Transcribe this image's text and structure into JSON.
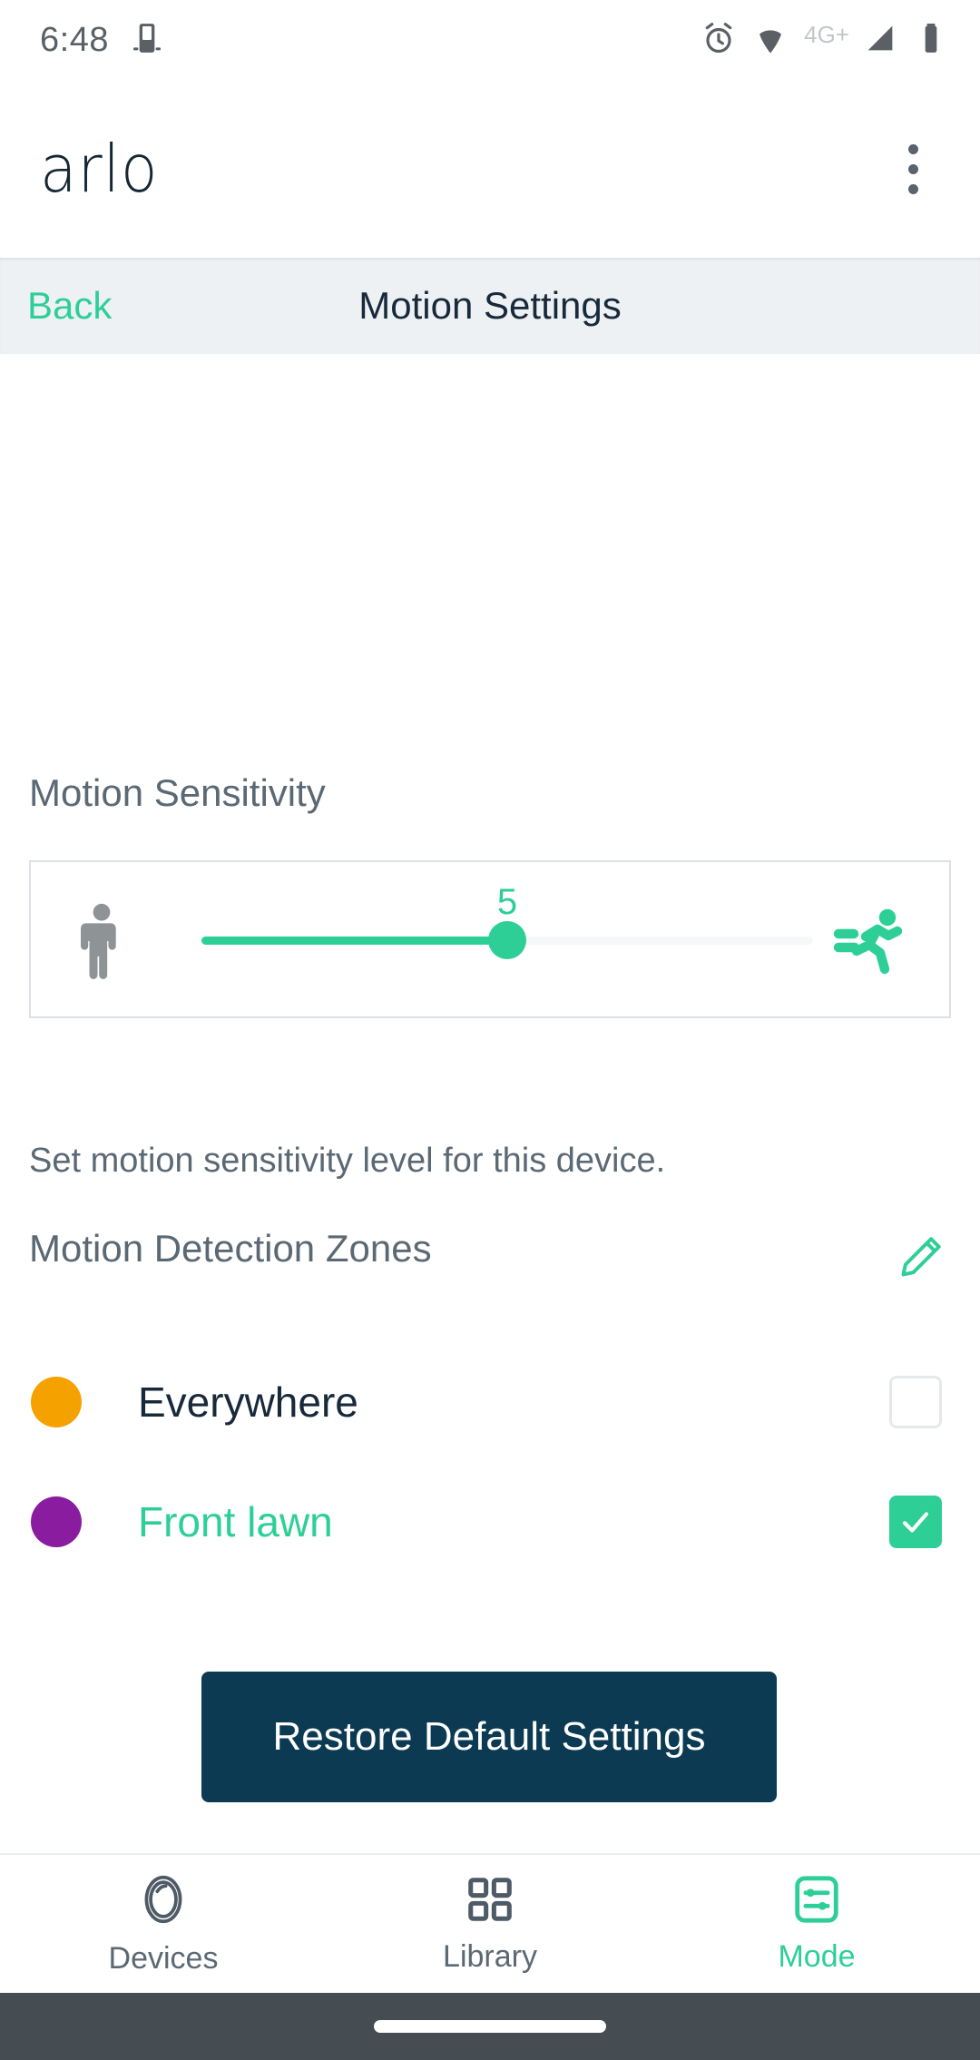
{
  "status_bar": {
    "time": "6:48",
    "icons": [
      "app-cast-icon",
      "alarm-icon",
      "wifi-icon",
      "signal-icon",
      "battery-icon"
    ],
    "network_label": "4G+"
  },
  "app_bar": {
    "brand": "arlo",
    "overflow_icon": "kebab-menu-icon"
  },
  "nav_bar": {
    "back_label": "Back",
    "title": "Motion Settings"
  },
  "sensitivity": {
    "section_title": "Motion Sensitivity",
    "value": "5",
    "min_icon": "standing-person-icon",
    "max_icon": "running-person-icon",
    "fill_percent": 50,
    "helper_text": "Set motion sensitivity level for this device."
  },
  "zones": {
    "section_title": "Motion Detection Zones",
    "edit_icon": "pencil-edit-icon",
    "items": [
      {
        "label": "Everywhere",
        "color": "#f5a100",
        "checked": false
      },
      {
        "label": "Front lawn",
        "color": "#8a1ca0",
        "checked": true
      }
    ]
  },
  "actions": {
    "restore_label": "Restore Default Settings"
  },
  "tab_bar": {
    "tabs": [
      {
        "label": "Devices",
        "icon": "camera-lens-icon",
        "active": false
      },
      {
        "label": "Library",
        "icon": "grid-squares-icon",
        "active": false
      },
      {
        "label": "Mode",
        "icon": "sliders-icon",
        "active": true
      }
    ]
  },
  "theme": {
    "accent_green": "#2ecf97",
    "dark_navy": "#0b3a52",
    "text_gray": "#5b6975",
    "navbar_bg": "#eef1f4"
  }
}
